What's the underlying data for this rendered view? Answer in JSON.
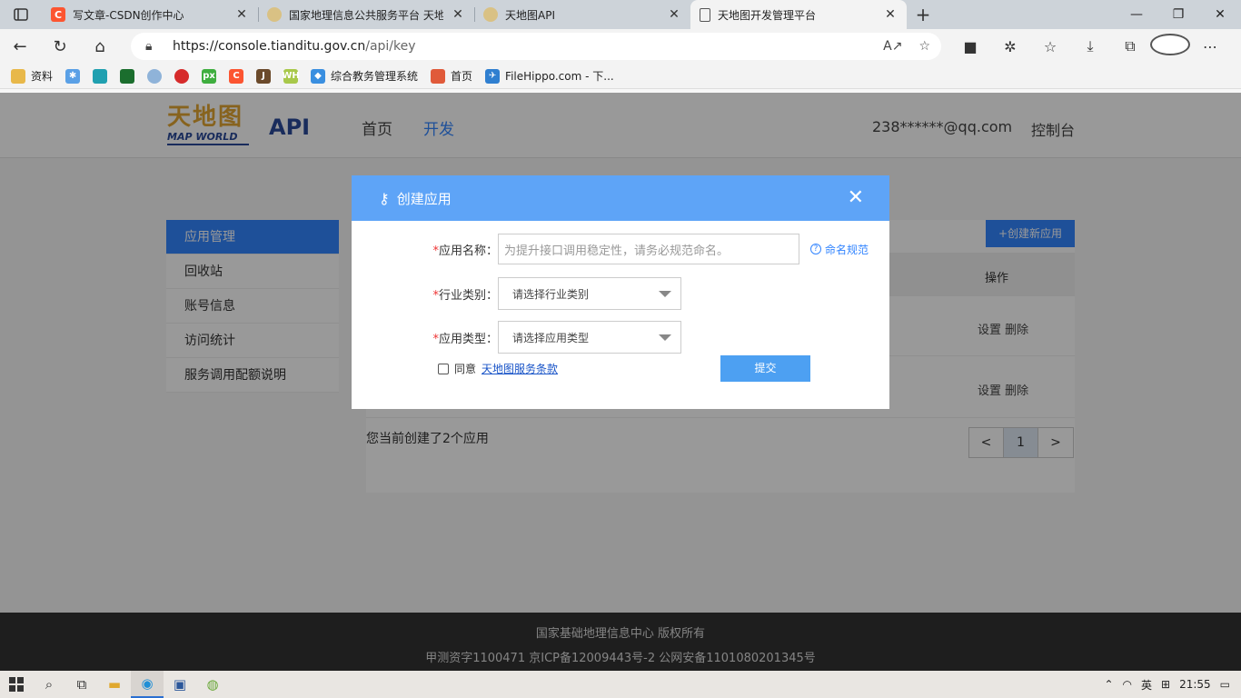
{
  "browser": {
    "tabs": [
      {
        "title": "写文章-CSDN创作中心",
        "icon": "csdn-icon",
        "active": false
      },
      {
        "title": "国家地理信息公共服务平台 天地图",
        "icon": "globe-icon",
        "active": false
      },
      {
        "title": "天地图API",
        "icon": "globe-icon",
        "active": false
      },
      {
        "title": "天地图开发管理平台",
        "icon": "document-icon",
        "active": true
      }
    ],
    "url_host": "https://console.tianditu.gov.cn",
    "url_path": "/api/key",
    "bookmarks": [
      "资料",
      "综合教务管理系统",
      "首页",
      "FileHippo.com - 下..."
    ]
  },
  "header": {
    "logo_cn": "天地图",
    "logo_en": "MAP WORLD",
    "logo_api": "API",
    "nav": {
      "home": "首页",
      "dev": "开发"
    },
    "account": "238******@qq.com",
    "console": "控制台"
  },
  "sidebar": {
    "items": [
      "应用管理",
      "回收站",
      "账号信息",
      "访问统计",
      "服务调用配额说明"
    ]
  },
  "main": {
    "create_button": "+创建新应用",
    "op_header": "操作",
    "row_ops": [
      "设置",
      "删除"
    ],
    "count_text": "您当前创建了2个应用",
    "pager": {
      "prev": "<",
      "current": "1",
      "next": ">"
    }
  },
  "footer": {
    "line1": "国家基础地理信息中心  版权所有",
    "line2": "甲测资字1100471  京ICP备12009443号-2  公网安备1101080201345号"
  },
  "modal": {
    "title": "创建应用",
    "required_mark": "*",
    "name_label": "应用名称：",
    "name_placeholder": "为提升接口调用稳定性，请务必规范命名。",
    "naming_rule": "命名规范",
    "industry_label": "行业类别：",
    "industry_placeholder": "请选择行业类别",
    "apptype_label": "应用类型：",
    "apptype_placeholder": "请选择应用类型",
    "agree_text": "同意",
    "agree_link": "天地图服务条款",
    "submit": "提交"
  },
  "taskbar": {
    "lang": "英",
    "time": "21:55"
  }
}
